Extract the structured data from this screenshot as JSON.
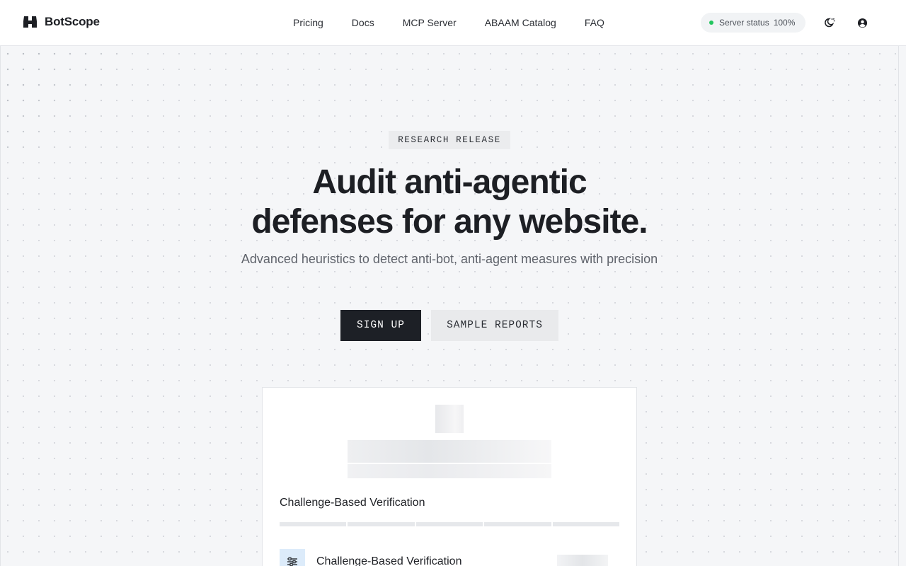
{
  "app": {
    "name": "BotScope"
  },
  "nav": {
    "items": [
      {
        "label": "Pricing"
      },
      {
        "label": "Docs"
      },
      {
        "label": "MCP Server"
      },
      {
        "label": "ABAAM Catalog"
      },
      {
        "label": "FAQ"
      }
    ]
  },
  "status": {
    "label": "Server status",
    "value": "100%",
    "color": "#22c55e"
  },
  "icons": {
    "logo": "binoculars-icon",
    "theme": "theme-toggle-icon",
    "user": "user-circle-icon",
    "row": "sliders-icon"
  },
  "hero": {
    "badge": "RESEARCH RELEASE",
    "headline_line1": "Audit anti-agentic",
    "headline_line2": "defenses for any website.",
    "subhead": "Advanced heuristics to detect anti-bot, anti-agent measures with precision",
    "primary_cta": "SIGN UP",
    "secondary_cta": "SAMPLE REPORTS"
  },
  "card": {
    "title": "Challenge-Based Verification",
    "row_title": "Challenge-Based Verification"
  },
  "colors": {
    "primary_button": "#1d2026",
    "accent_icon_bg": "#dcebfa",
    "background": "#f5f6f8"
  }
}
